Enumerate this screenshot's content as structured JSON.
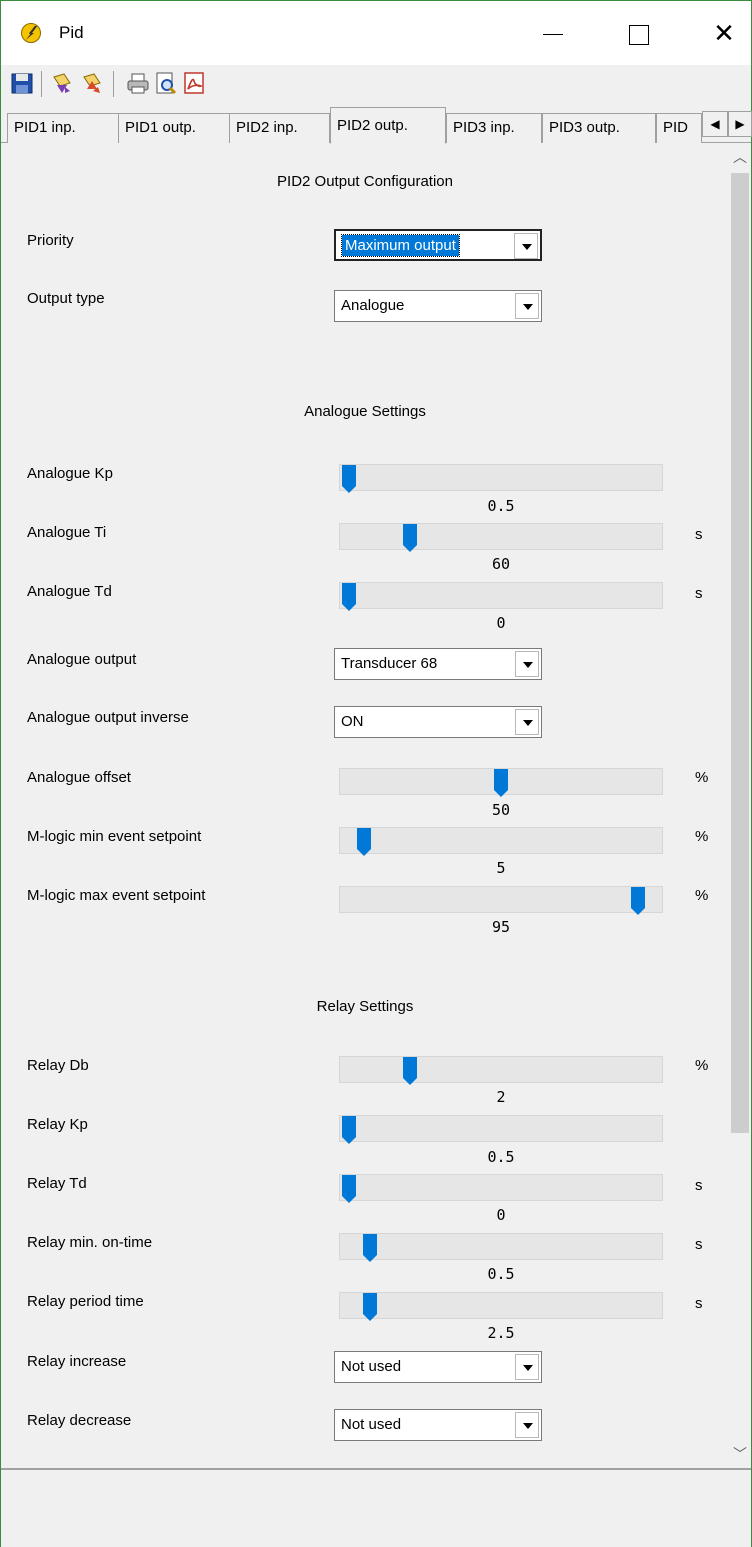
{
  "window": {
    "title": "Pid"
  },
  "toolbar": {
    "icons": [
      "save-icon",
      "read-icon",
      "write-icon",
      "print-icon",
      "print-preview-icon",
      "pdf-icon"
    ]
  },
  "tabs": [
    {
      "label": "PID1 inp.",
      "active": false
    },
    {
      "label": "PID1 outp.",
      "active": false
    },
    {
      "label": "PID2 inp.",
      "active": false
    },
    {
      "label": "PID2 outp.",
      "active": true
    },
    {
      "label": "PID3 inp.",
      "active": false
    },
    {
      "label": "PID3 outp.",
      "active": false
    },
    {
      "label": "PID",
      "active": false
    }
  ],
  "page": {
    "heading": "PID2 Output Configuration",
    "priority": {
      "label": "Priority",
      "value": "Maximum output"
    },
    "output_type": {
      "label": "Output type",
      "value": "Analogue"
    }
  },
  "analogue": {
    "heading": "Analogue Settings",
    "kp": {
      "label": "Analogue Kp",
      "value": "0.5",
      "unit": "",
      "level": 0.0
    },
    "ti": {
      "label": "Analogue Ti",
      "value": "60",
      "unit": "s",
      "level": 0.2
    },
    "td": {
      "label": "Analogue Td",
      "value": "0",
      "unit": "s",
      "level": 0.0
    },
    "output": {
      "label": "Analogue output",
      "value": "Transducer 68"
    },
    "output_inverse": {
      "label": "Analogue output inverse",
      "value": "ON"
    },
    "offset": {
      "label": "Analogue offset",
      "value": "50",
      "unit": "%",
      "level": 0.5
    },
    "min_event": {
      "label": "M-logic min event setpoint",
      "value": "5",
      "unit": "%",
      "level": 0.05
    },
    "max_event": {
      "label": "M-logic max event setpoint",
      "value": "95",
      "unit": "%",
      "level": 0.95
    }
  },
  "relay": {
    "heading": "Relay Settings",
    "db": {
      "label": "Relay Db",
      "value": "2",
      "unit": "%",
      "level": 0.2
    },
    "kp": {
      "label": "Relay Kp",
      "value": "0.5",
      "unit": "",
      "level": 0.0
    },
    "td": {
      "label": "Relay Td",
      "value": "0",
      "unit": "s",
      "level": 0.0
    },
    "min_on_time": {
      "label": "Relay min. on-time",
      "value": "0.5",
      "unit": "s",
      "level": 0.07
    },
    "period_time": {
      "label": "Relay period time",
      "value": "2.5",
      "unit": "s",
      "level": 0.07
    },
    "increase": {
      "label": "Relay increase",
      "value": "Not used"
    },
    "decrease": {
      "label": "Relay decrease",
      "value": "Not used"
    }
  },
  "colors": {
    "accent": "#0078d7",
    "window_border": "#3c8a3c",
    "track": "#e6e6e6"
  }
}
